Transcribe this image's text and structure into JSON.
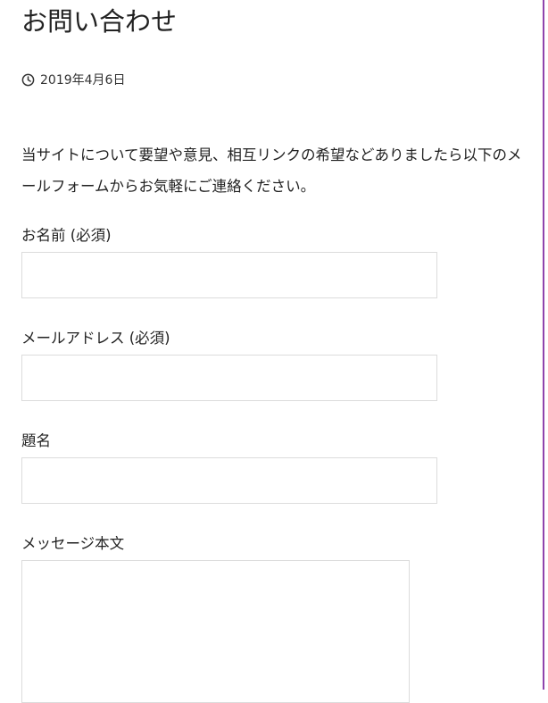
{
  "page": {
    "title": "お問い合わせ",
    "date": "2019年4月6日",
    "date_icon": "clock-icon",
    "intro": "当サイトについて要望や意見、相互リンクの希望などありましたら以下のメールフォームからお気軽にご連絡ください。"
  },
  "form": {
    "name_label": "お名前 (必須)",
    "name_value": "",
    "email_label": "メールアドレス (必須)",
    "email_value": "",
    "subject_label": "題名",
    "subject_value": "",
    "message_label": "メッセージ本文",
    "message_value": ""
  },
  "colors": {
    "right_border": "#8e44ad",
    "input_border": "#dcdcdc",
    "text": "#222222"
  }
}
